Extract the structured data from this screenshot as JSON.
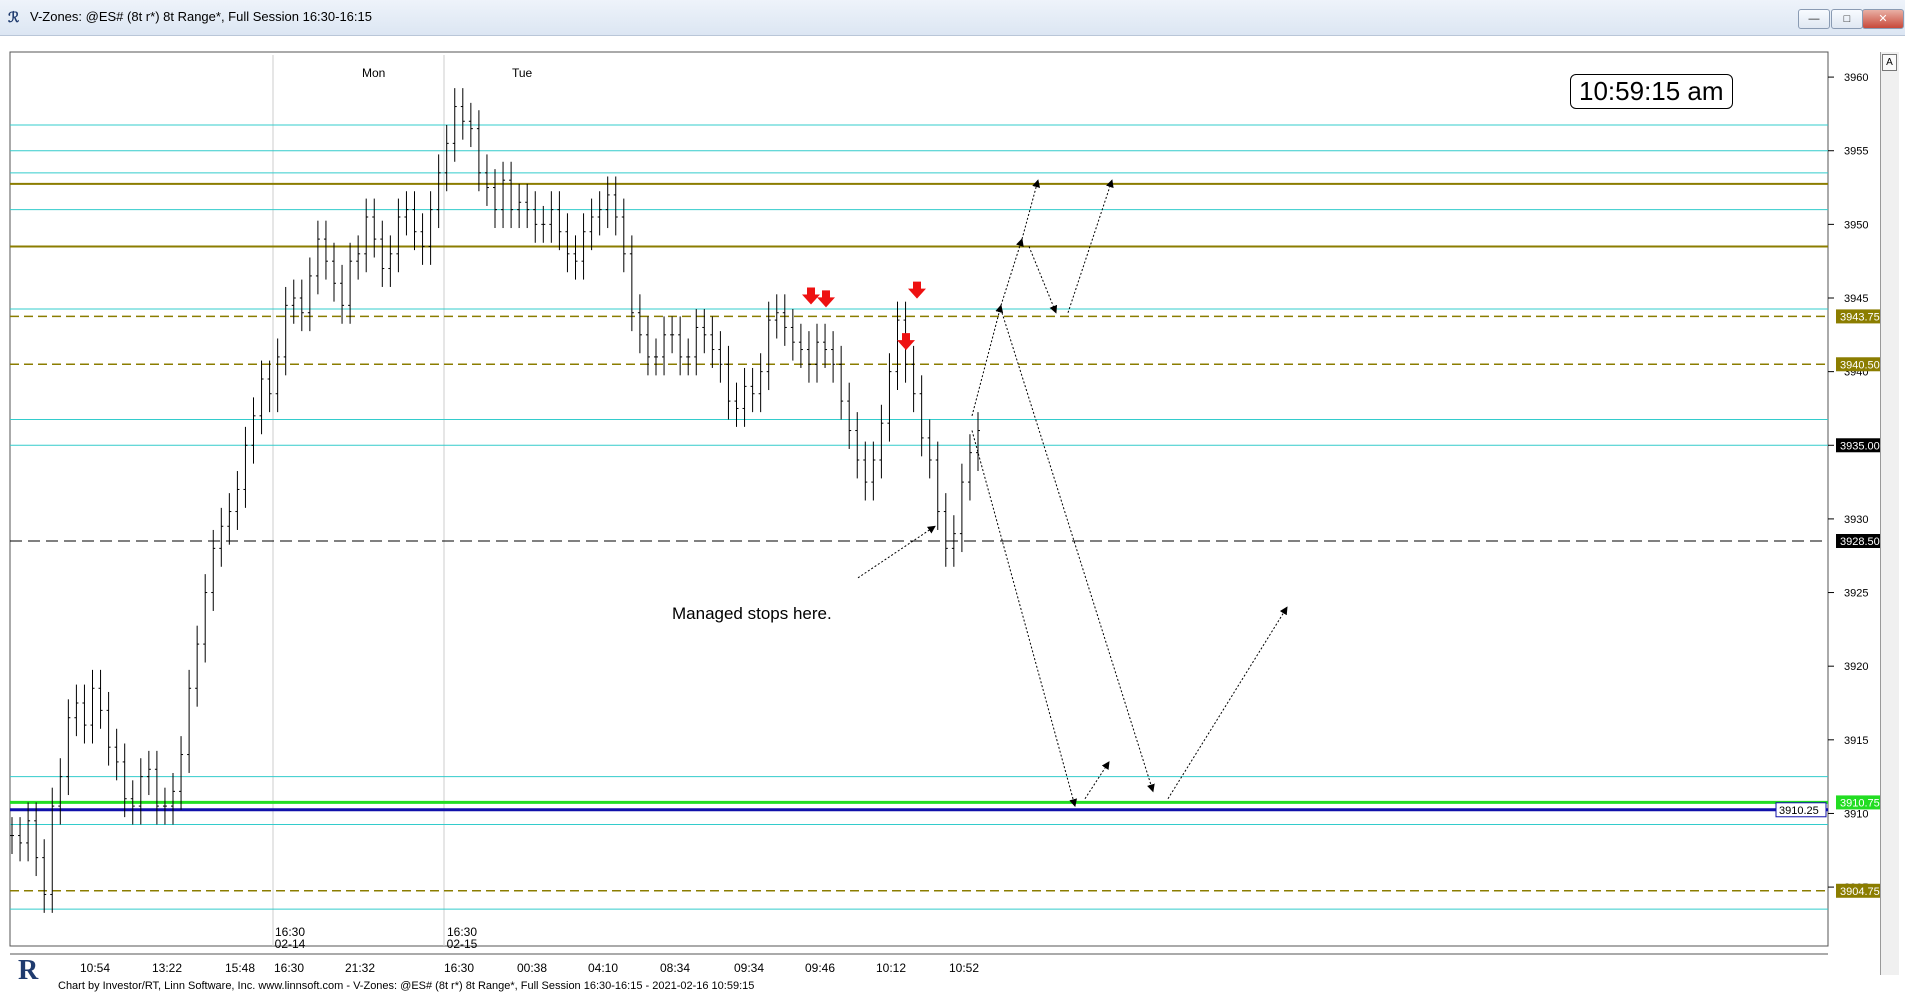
{
  "window": {
    "title": "V-Zones: @ES# (8t r*) 8t Range*, Full Session 16:30-16:15",
    "app_icon": "chart-app-icon",
    "buttons": [
      "minimize-icon",
      "maximize-icon",
      "close-icon"
    ]
  },
  "clock": "10:59:15 am",
  "scale_button": "A",
  "annotation": "Managed stops here.",
  "footer": "Chart by Investor/RT, Linn Software, Inc. www.linnsoft.com - V-Zones: @ES# (8t r*) 8t Range*, Full Session 16:30-16:15 - 2021-02-16 10:59:15",
  "day_labels": [
    "Mon",
    "Tue"
  ],
  "session_markers": [
    {
      "time": "16:30",
      "date": "02-14"
    },
    {
      "time": "16:30",
      "date": "02-15"
    }
  ],
  "x_tick_labels": [
    "10:54",
    "13:22",
    "15:48",
    "16:30",
    "21:32",
    "16:30",
    "00:38",
    "04:10",
    "08:34",
    "09:34",
    "09:46",
    "10:12",
    "10:52"
  ],
  "price_labels": [
    {
      "value": 3943.75,
      "text": "3943.75",
      "color": "#8b7d00",
      "text_color": "#ffffff"
    },
    {
      "value": 3940.5,
      "text": "3940.50",
      "color": "#8b7d00",
      "text_color": "#ffffff"
    },
    {
      "value": 3935.0,
      "text": "3935.00",
      "color": "#000000",
      "text_color": "#ffffff"
    },
    {
      "value": 3928.5,
      "text": "3928.50",
      "color": "#000000",
      "text_color": "#ffffff"
    },
    {
      "value": 3910.75,
      "text": "3910.75",
      "color": "#22dd22",
      "text_color": "#ffffff"
    },
    {
      "value": 3904.75,
      "text": "3904.75",
      "color": "#8b7d00",
      "text_color": "#ffffff"
    }
  ],
  "inline_label": {
    "value": 3910.25,
    "text": "3910.25"
  },
  "colors": {
    "cyan_level": "#33cccc",
    "olive_level": "#8b7d00",
    "green_level": "#22dd22",
    "blue_level": "#1010aa",
    "arrow_red": "#ee1111",
    "price_bars": "#000000"
  },
  "chart_data": {
    "type": "bar",
    "title": "V-Zones: @ES# (8t r*) 8t Range*, Full Session 16:30-16:15",
    "ylim": [
      3901,
      3961.5
    ],
    "y_ticks": [
      3905,
      3910,
      3915,
      3920,
      3925,
      3930,
      3935,
      3940,
      3945,
      3950,
      3955,
      3960
    ],
    "levels": [
      {
        "value": 3956.75,
        "style": "cyan"
      },
      {
        "value": 3955.0,
        "style": "cyan"
      },
      {
        "value": 3953.5,
        "style": "cyan"
      },
      {
        "value": 3952.75,
        "style": "olive-solid"
      },
      {
        "value": 3951.0,
        "style": "cyan"
      },
      {
        "value": 3948.5,
        "style": "olive-solid"
      },
      {
        "value": 3944.25,
        "style": "cyan"
      },
      {
        "value": 3943.75,
        "style": "olive-dashed"
      },
      {
        "value": 3940.5,
        "style": "olive-dashed"
      },
      {
        "value": 3936.75,
        "style": "cyan"
      },
      {
        "value": 3935.0,
        "style": "cyan"
      },
      {
        "value": 3928.5,
        "style": "black-dashed"
      },
      {
        "value": 3912.5,
        "style": "cyan"
      },
      {
        "value": 3910.75,
        "style": "green"
      },
      {
        "value": 3910.25,
        "style": "blue"
      },
      {
        "value": 3909.25,
        "style": "cyan"
      },
      {
        "value": 3904.75,
        "style": "olive-dashed"
      },
      {
        "value": 3903.5,
        "style": "cyan"
      }
    ],
    "closes": [
      3908.5,
      3908,
      3909.5,
      3907,
      3904.5,
      3910.5,
      3912.5,
      3916.5,
      3917.5,
      3916,
      3918.5,
      3917,
      3914.5,
      3913.5,
      3911,
      3910.5,
      3912.5,
      3913,
      3910.5,
      3910.5,
      3911.5,
      3914,
      3918.5,
      3921.5,
      3925,
      3928,
      3929.5,
      3930.5,
      3932,
      3935,
      3937,
      3939.5,
      3938.5,
      3941,
      3944.5,
      3945,
      3944,
      3946.5,
      3949,
      3947.5,
      3946,
      3944.5,
      3947.5,
      3948,
      3950.5,
      3949,
      3947,
      3948,
      3950.5,
      3951,
      3949.5,
      3948.5,
      3951,
      3953.5,
      3955.5,
      3958,
      3957,
      3956.5,
      3953.5,
      3952.5,
      3951,
      3953,
      3951,
      3951.5,
      3951,
      3950,
      3950,
      3951,
      3949.5,
      3948,
      3947.5,
      3949.5,
      3950.5,
      3951,
      3952,
      3950.5,
      3948,
      3944,
      3942.5,
      3941,
      3941,
      3942.5,
      3942.5,
      3941,
      3941,
      3943,
      3942.5,
      3941.5,
      3940.5,
      3938,
      3937.5,
      3939,
      3938.5,
      3940,
      3943.5,
      3944,
      3943,
      3942,
      3941.5,
      3940.5,
      3942,
      3941.5,
      3940.5,
      3938,
      3936,
      3934,
      3932.5,
      3934,
      3936.5,
      3940,
      3943.5,
      3940.5,
      3938.5,
      3935.5,
      3934,
      3930.5,
      3928,
      3929,
      3932.5,
      3934.5,
      3936
    ]
  }
}
